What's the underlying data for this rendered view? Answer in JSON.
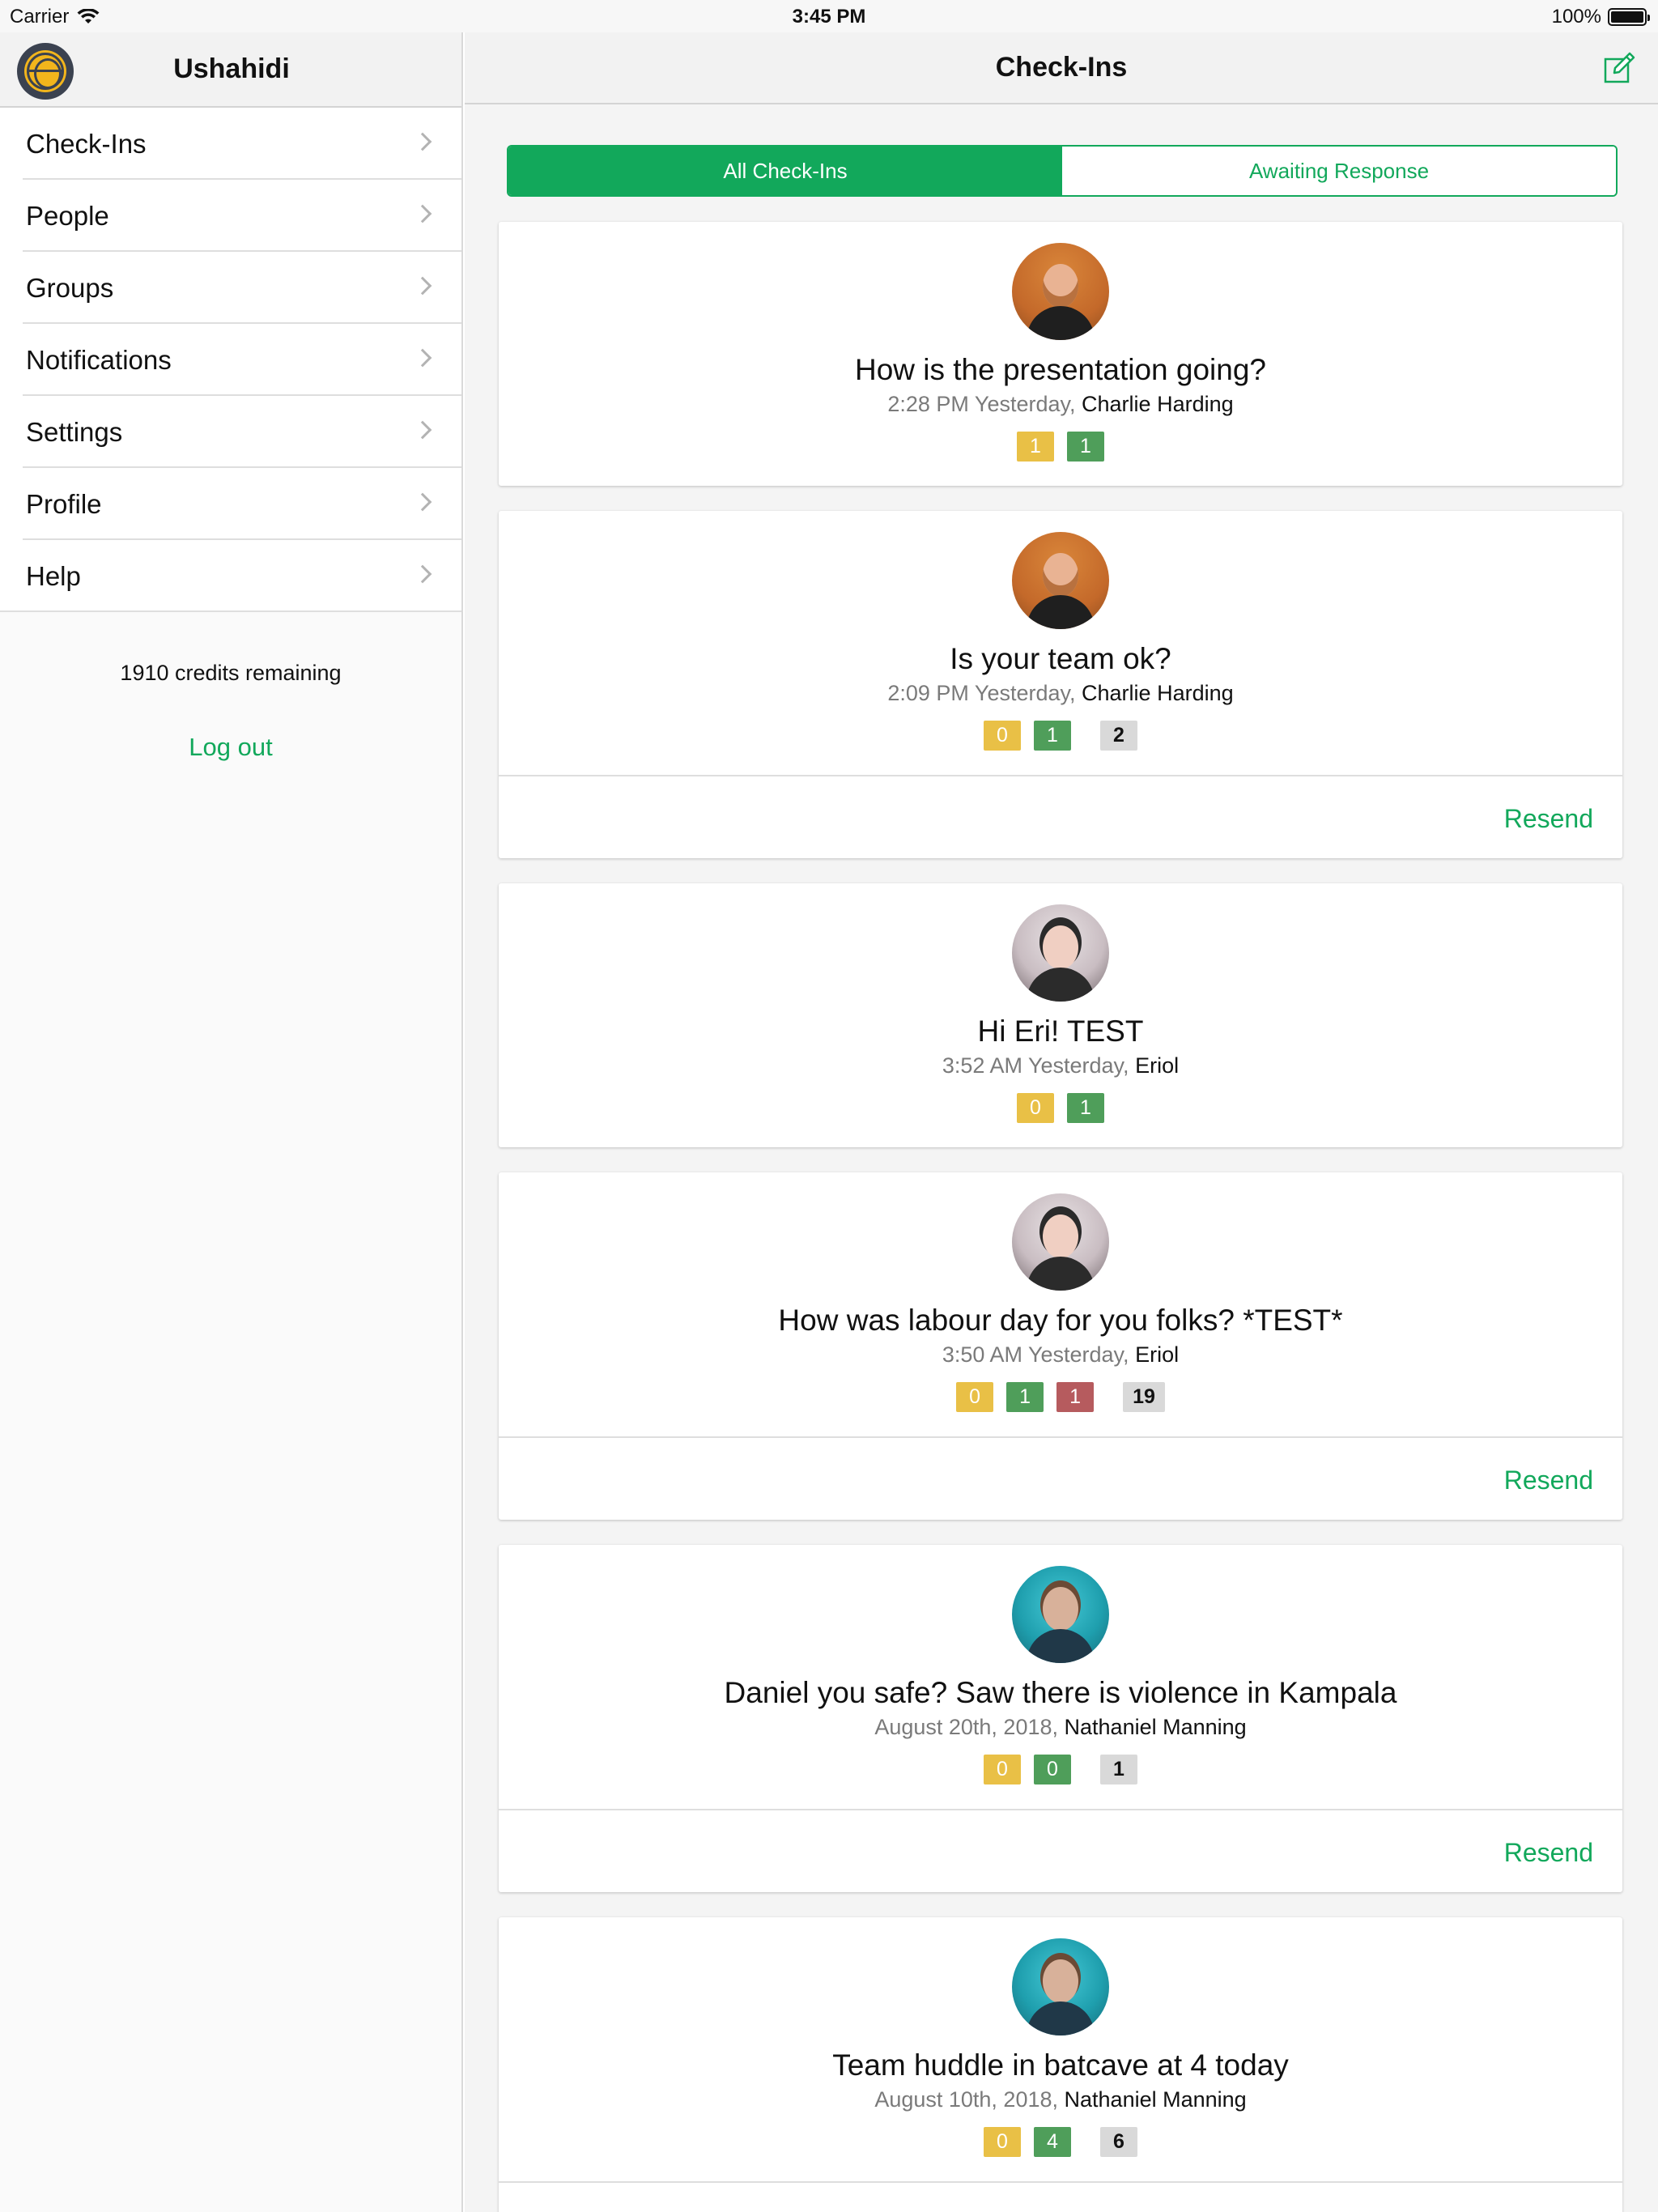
{
  "status_bar": {
    "carrier": "Carrier",
    "time": "3:45 PM",
    "battery": "100%"
  },
  "sidebar": {
    "title": "Ushahidi",
    "items": [
      {
        "label": "Check-Ins"
      },
      {
        "label": "People"
      },
      {
        "label": "Groups"
      },
      {
        "label": "Notifications"
      },
      {
        "label": "Settings"
      },
      {
        "label": "Profile"
      },
      {
        "label": "Help"
      }
    ],
    "credits": "1910 credits remaining",
    "logout": "Log out"
  },
  "main": {
    "title": "Check-Ins",
    "segments": [
      {
        "label": "All Check-Ins",
        "active": true
      },
      {
        "label": "Awaiting Response",
        "active": false
      }
    ],
    "cards": [
      {
        "question": "How is the presentation going?",
        "time": "2:28 PM Yesterday,",
        "author": "Charlie Harding",
        "badges": [
          "1",
          "1"
        ],
        "resend": null
      },
      {
        "question": "Is your team ok?",
        "time": "2:09 PM Yesterday,",
        "author": "Charlie Harding",
        "badges": [
          "0",
          "1",
          "2"
        ],
        "resend": "Resend"
      },
      {
        "question": "Hi Eri! TEST",
        "time": "3:52 AM Yesterday,",
        "author": "Eriol",
        "badges": [
          "0",
          "1"
        ],
        "resend": null
      },
      {
        "question": "How was labour day for you folks? *TEST*",
        "time": "3:50 AM Yesterday,",
        "author": "Eriol",
        "badges": [
          "0",
          "1",
          "1",
          "19"
        ],
        "resend": "Resend"
      },
      {
        "question": "Daniel you safe? Saw there is violence in Kampala",
        "time": "August 20th, 2018,",
        "author": "Nathaniel Manning",
        "badges": [
          "0",
          "0",
          "1"
        ],
        "resend": "Resend"
      },
      {
        "question": "Team huddle in batcave at 4 today",
        "time": "August 10th, 2018,",
        "author": "Nathaniel Manning",
        "badges": [
          "0",
          "4",
          "6"
        ],
        "resend": null
      }
    ]
  },
  "colors": {
    "accent": "#12a85b",
    "badge_yellow": "#e9c046",
    "badge_green": "#4f9e5a",
    "badge_red": "#b65b5e",
    "badge_gray": "#d9d9d9"
  }
}
